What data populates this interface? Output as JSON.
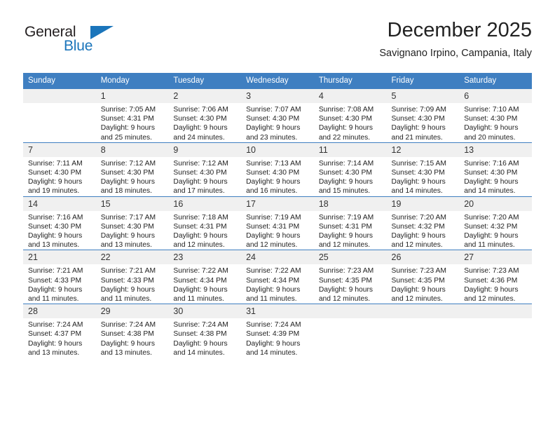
{
  "brand": {
    "name_top": "General",
    "name_bottom": "Blue",
    "accent_color": "#1b75bb"
  },
  "header": {
    "title": "December 2025",
    "subtitle": "Savignano Irpino, Campania, Italy"
  },
  "calendar": {
    "header_color": "#3f7fc1",
    "weekday_headers": [
      "Sunday",
      "Monday",
      "Tuesday",
      "Wednesday",
      "Thursday",
      "Friday",
      "Saturday"
    ],
    "weeks": [
      [
        {
          "day": "",
          "lines": []
        },
        {
          "day": "1",
          "lines": [
            "Sunrise: 7:05 AM",
            "Sunset: 4:31 PM",
            "Daylight: 9 hours",
            "and 25 minutes."
          ]
        },
        {
          "day": "2",
          "lines": [
            "Sunrise: 7:06 AM",
            "Sunset: 4:30 PM",
            "Daylight: 9 hours",
            "and 24 minutes."
          ]
        },
        {
          "day": "3",
          "lines": [
            "Sunrise: 7:07 AM",
            "Sunset: 4:30 PM",
            "Daylight: 9 hours",
            "and 23 minutes."
          ]
        },
        {
          "day": "4",
          "lines": [
            "Sunrise: 7:08 AM",
            "Sunset: 4:30 PM",
            "Daylight: 9 hours",
            "and 22 minutes."
          ]
        },
        {
          "day": "5",
          "lines": [
            "Sunrise: 7:09 AM",
            "Sunset: 4:30 PM",
            "Daylight: 9 hours",
            "and 21 minutes."
          ]
        },
        {
          "day": "6",
          "lines": [
            "Sunrise: 7:10 AM",
            "Sunset: 4:30 PM",
            "Daylight: 9 hours",
            "and 20 minutes."
          ]
        }
      ],
      [
        {
          "day": "7",
          "lines": [
            "Sunrise: 7:11 AM",
            "Sunset: 4:30 PM",
            "Daylight: 9 hours",
            "and 19 minutes."
          ]
        },
        {
          "day": "8",
          "lines": [
            "Sunrise: 7:12 AM",
            "Sunset: 4:30 PM",
            "Daylight: 9 hours",
            "and 18 minutes."
          ]
        },
        {
          "day": "9",
          "lines": [
            "Sunrise: 7:12 AM",
            "Sunset: 4:30 PM",
            "Daylight: 9 hours",
            "and 17 minutes."
          ]
        },
        {
          "day": "10",
          "lines": [
            "Sunrise: 7:13 AM",
            "Sunset: 4:30 PM",
            "Daylight: 9 hours",
            "and 16 minutes."
          ]
        },
        {
          "day": "11",
          "lines": [
            "Sunrise: 7:14 AM",
            "Sunset: 4:30 PM",
            "Daylight: 9 hours",
            "and 15 minutes."
          ]
        },
        {
          "day": "12",
          "lines": [
            "Sunrise: 7:15 AM",
            "Sunset: 4:30 PM",
            "Daylight: 9 hours",
            "and 14 minutes."
          ]
        },
        {
          "day": "13",
          "lines": [
            "Sunrise: 7:16 AM",
            "Sunset: 4:30 PM",
            "Daylight: 9 hours",
            "and 14 minutes."
          ]
        }
      ],
      [
        {
          "day": "14",
          "lines": [
            "Sunrise: 7:16 AM",
            "Sunset: 4:30 PM",
            "Daylight: 9 hours",
            "and 13 minutes."
          ]
        },
        {
          "day": "15",
          "lines": [
            "Sunrise: 7:17 AM",
            "Sunset: 4:30 PM",
            "Daylight: 9 hours",
            "and 13 minutes."
          ]
        },
        {
          "day": "16",
          "lines": [
            "Sunrise: 7:18 AM",
            "Sunset: 4:31 PM",
            "Daylight: 9 hours",
            "and 12 minutes."
          ]
        },
        {
          "day": "17",
          "lines": [
            "Sunrise: 7:19 AM",
            "Sunset: 4:31 PM",
            "Daylight: 9 hours",
            "and 12 minutes."
          ]
        },
        {
          "day": "18",
          "lines": [
            "Sunrise: 7:19 AM",
            "Sunset: 4:31 PM",
            "Daylight: 9 hours",
            "and 12 minutes."
          ]
        },
        {
          "day": "19",
          "lines": [
            "Sunrise: 7:20 AM",
            "Sunset: 4:32 PM",
            "Daylight: 9 hours",
            "and 12 minutes."
          ]
        },
        {
          "day": "20",
          "lines": [
            "Sunrise: 7:20 AM",
            "Sunset: 4:32 PM",
            "Daylight: 9 hours",
            "and 11 minutes."
          ]
        }
      ],
      [
        {
          "day": "21",
          "lines": [
            "Sunrise: 7:21 AM",
            "Sunset: 4:33 PM",
            "Daylight: 9 hours",
            "and 11 minutes."
          ]
        },
        {
          "day": "22",
          "lines": [
            "Sunrise: 7:21 AM",
            "Sunset: 4:33 PM",
            "Daylight: 9 hours",
            "and 11 minutes."
          ]
        },
        {
          "day": "23",
          "lines": [
            "Sunrise: 7:22 AM",
            "Sunset: 4:34 PM",
            "Daylight: 9 hours",
            "and 11 minutes."
          ]
        },
        {
          "day": "24",
          "lines": [
            "Sunrise: 7:22 AM",
            "Sunset: 4:34 PM",
            "Daylight: 9 hours",
            "and 11 minutes."
          ]
        },
        {
          "day": "25",
          "lines": [
            "Sunrise: 7:23 AM",
            "Sunset: 4:35 PM",
            "Daylight: 9 hours",
            "and 12 minutes."
          ]
        },
        {
          "day": "26",
          "lines": [
            "Sunrise: 7:23 AM",
            "Sunset: 4:35 PM",
            "Daylight: 9 hours",
            "and 12 minutes."
          ]
        },
        {
          "day": "27",
          "lines": [
            "Sunrise: 7:23 AM",
            "Sunset: 4:36 PM",
            "Daylight: 9 hours",
            "and 12 minutes."
          ]
        }
      ],
      [
        {
          "day": "28",
          "lines": [
            "Sunrise: 7:24 AM",
            "Sunset: 4:37 PM",
            "Daylight: 9 hours",
            "and 13 minutes."
          ]
        },
        {
          "day": "29",
          "lines": [
            "Sunrise: 7:24 AM",
            "Sunset: 4:38 PM",
            "Daylight: 9 hours",
            "and 13 minutes."
          ]
        },
        {
          "day": "30",
          "lines": [
            "Sunrise: 7:24 AM",
            "Sunset: 4:38 PM",
            "Daylight: 9 hours",
            "and 14 minutes."
          ]
        },
        {
          "day": "31",
          "lines": [
            "Sunrise: 7:24 AM",
            "Sunset: 4:39 PM",
            "Daylight: 9 hours",
            "and 14 minutes."
          ]
        },
        {
          "day": "",
          "lines": []
        },
        {
          "day": "",
          "lines": []
        },
        {
          "day": "",
          "lines": []
        }
      ]
    ]
  }
}
